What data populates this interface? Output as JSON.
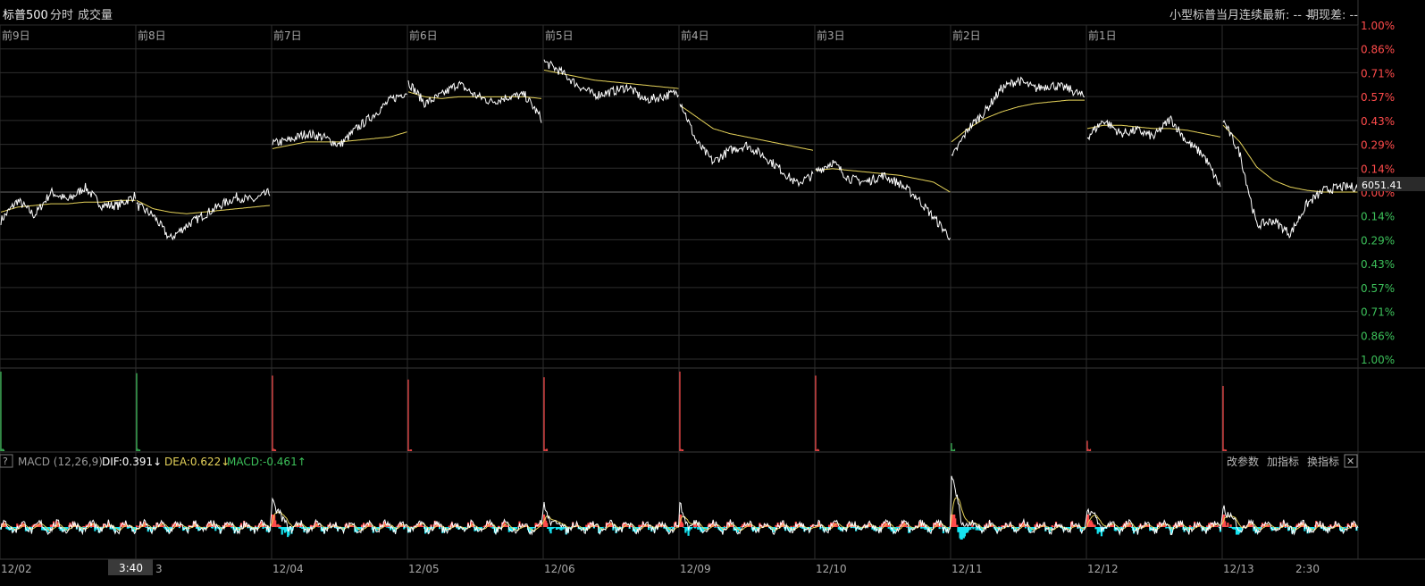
{
  "header": {
    "symbol": "标普500",
    "tab_intraday": "分时",
    "tab_volume": "成交量",
    "right_info": "小型标普当月连续最新: -- -",
    "spread": "期现差: --"
  },
  "macd": {
    "help": "?",
    "label": "MACD (12,26,9)",
    "dif": "DIF:0.391↓",
    "dea": "DEA:0.622↓",
    "macd": "MACD:-0.461↑",
    "btn_params": "改参数",
    "btn_add": "加指标",
    "btn_switch": "换指标",
    "btn_close": "✕"
  },
  "cursor": {
    "time_label": "3:40"
  },
  "colors": {
    "up": "#ff4b4b",
    "down": "#3cc05a",
    "price": "#ffffff",
    "avg": "#e6d35a",
    "dea": "#e6d35a",
    "hist_neg": "#16e3f0"
  },
  "chart_data": {
    "type": "line",
    "title": "标普500",
    "ref_price_label": "6051.41",
    "y_ticks_up": [
      "1.00%",
      "0.86%",
      "0.71%",
      "0.57%",
      "0.43%",
      "0.29%",
      "0.14%",
      "0.00%"
    ],
    "y_ticks_down": [
      "0.14%",
      "0.29%",
      "0.43%",
      "0.57%",
      "0.71%",
      "0.86%",
      "1.00%"
    ],
    "ylim_pct": [
      -1.0,
      1.0
    ],
    "day_labels": [
      "前9日",
      "前8日",
      "前7日",
      "前6日",
      "前5日",
      "前4日",
      "前3日",
      "前2日",
      "前1日",
      ""
    ],
    "x_dates": [
      "12/02",
      "",
      "12/04",
      "12/05",
      "12/06",
      "12/09",
      "12/10",
      "12/11",
      "12/12",
      "12/13"
    ],
    "x_extra_labels": [
      "3",
      "2:30"
    ],
    "series": [
      {
        "name": "price",
        "unit": "%",
        "values": [
          [
            -0.17,
            -0.05,
            -0.14,
            0.0,
            -0.05,
            0.03,
            -0.08,
            -0.08,
            -0.02
          ],
          [
            -0.08,
            -0.14,
            -0.28,
            -0.2,
            -0.14,
            -0.08,
            -0.03,
            -0.05,
            0.0
          ],
          [
            0.29,
            0.31,
            0.35,
            0.33,
            0.28,
            0.38,
            0.46,
            0.55,
            0.6
          ],
          [
            0.66,
            0.53,
            0.58,
            0.65,
            0.58,
            0.54,
            0.57,
            0.58,
            0.44
          ],
          [
            0.78,
            0.72,
            0.64,
            0.58,
            0.6,
            0.63,
            0.55,
            0.57,
            0.6
          ],
          [
            0.55,
            0.3,
            0.18,
            0.25,
            0.28,
            0.22,
            0.14,
            0.05,
            0.1
          ],
          [
            0.12,
            0.18,
            0.08,
            0.06,
            0.1,
            0.05,
            -0.03,
            -0.15,
            -0.27
          ],
          [
            0.2,
            0.38,
            0.48,
            0.62,
            0.67,
            0.62,
            0.64,
            0.62,
            0.57
          ],
          [
            0.33,
            0.43,
            0.35,
            0.37,
            0.33,
            0.44,
            0.3,
            0.22,
            0.03
          ],
          [
            0.43,
            0.23,
            -0.2,
            -0.17,
            -0.25,
            -0.07,
            0.01,
            0.03,
            0.03
          ]
        ]
      },
      {
        "name": "average",
        "unit": "%",
        "values": [
          [
            -0.12,
            -0.09,
            -0.08,
            -0.07,
            -0.07,
            -0.06,
            -0.06,
            -0.05,
            -0.05
          ],
          [
            -0.05,
            -0.1,
            -0.12,
            -0.13,
            -0.12,
            -0.11,
            -0.1,
            -0.09,
            -0.08
          ],
          [
            0.26,
            0.28,
            0.3,
            0.3,
            0.3,
            0.31,
            0.32,
            0.33,
            0.36
          ],
          [
            0.6,
            0.57,
            0.56,
            0.57,
            0.57,
            0.57,
            0.57,
            0.57,
            0.56
          ],
          [
            0.73,
            0.71,
            0.69,
            0.67,
            0.66,
            0.65,
            0.64,
            0.63,
            0.62
          ],
          [
            0.52,
            0.45,
            0.38,
            0.35,
            0.33,
            0.31,
            0.29,
            0.27,
            0.25
          ],
          [
            0.13,
            0.14,
            0.13,
            0.12,
            0.11,
            0.1,
            0.08,
            0.06,
            0.0
          ],
          [
            0.3,
            0.38,
            0.44,
            0.48,
            0.51,
            0.53,
            0.54,
            0.55,
            0.55
          ],
          [
            0.38,
            0.4,
            0.4,
            0.39,
            0.38,
            0.38,
            0.37,
            0.35,
            0.33
          ],
          [
            0.4,
            0.3,
            0.15,
            0.07,
            0.03,
            0.01,
            0.0,
            0.0,
            0.0
          ]
        ]
      }
    ],
    "volume_spikes": [
      {
        "day": "前9日",
        "value": 100,
        "dir": "down"
      },
      {
        "day": "前8日",
        "value": 98,
        "dir": "down"
      },
      {
        "day": "前7日",
        "value": 95,
        "dir": "up"
      },
      {
        "day": "前6日",
        "value": 90,
        "dir": "up"
      },
      {
        "day": "前5日",
        "value": 93,
        "dir": "up"
      },
      {
        "day": "前4日",
        "value": 100,
        "dir": "up"
      },
      {
        "day": "前3日",
        "value": 95,
        "dir": "up"
      },
      {
        "day": "前2日",
        "value": 10,
        "dir": "down"
      },
      {
        "day": "前1日",
        "value": 13,
        "dir": "up"
      },
      {
        "day": "today",
        "value": 82,
        "dir": "up"
      }
    ],
    "macd_day_open_peaks": [
      0,
      0,
      0.9,
      0,
      0.65,
      0.55,
      0,
      1.6,
      0.65,
      0.75
    ]
  }
}
